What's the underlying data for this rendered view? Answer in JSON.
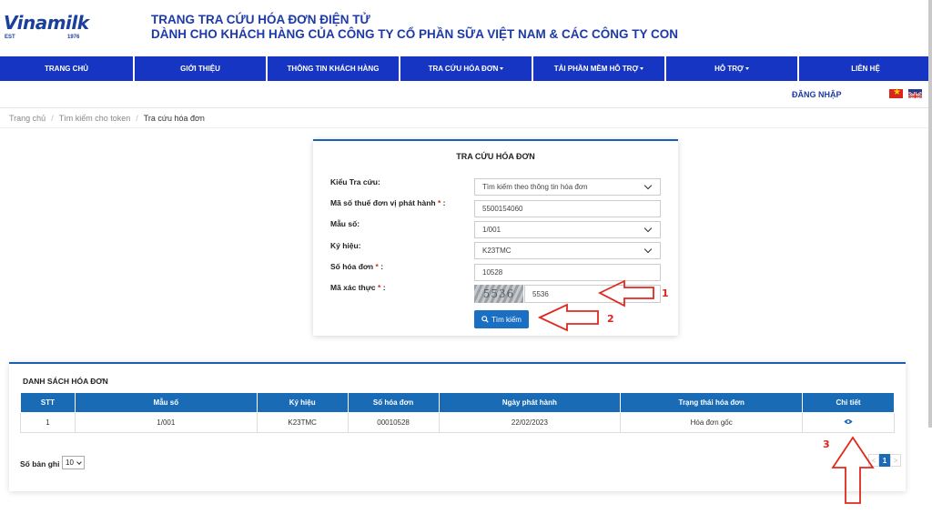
{
  "logo": {
    "brand": "Vinamilk",
    "est": "EST",
    "year": "1976"
  },
  "header": {
    "title_line1": "TRANG TRA CỨU HÓA ĐƠN ĐIỆN TỬ",
    "title_line2": "DÀNH CHO KHÁCH HÀNG CỦA CÔNG TY CỔ PHẦN SỮA VIỆT NAM & CÁC CÔNG TY CON"
  },
  "nav": {
    "items": [
      {
        "label": "TRANG CHỦ"
      },
      {
        "label": "GIỚI THIỆU"
      },
      {
        "label": "THÔNG TIN KHÁCH HÀNG"
      },
      {
        "label": "TRA CỨU HÓA ĐƠN"
      },
      {
        "label": "TẢI PHẦN MỀM HỖ TRỢ"
      },
      {
        "label": "HỖ TRỢ"
      },
      {
        "label": "LIÊN HỆ"
      }
    ]
  },
  "login_label": "ĐĂNG NHẬP",
  "languages": [
    "vi-flag-icon",
    "uk-flag-icon"
  ],
  "breadcrumb": [
    "Trang chủ",
    "Tìm kiếm cho token",
    "Tra cứu hóa đơn"
  ],
  "search_form": {
    "title": "TRA CỨU HÓA ĐƠN",
    "lookup_type_label": "Kiểu Tra cứu:",
    "lookup_type_value": "Tìm kiếm theo thông tin hóa đơn",
    "tax_code_label": "Mã số thuế đơn vị phát hành",
    "tax_code_value": "5500154060",
    "template_label": "Mẫu số:",
    "template_value": "1/001",
    "symbol_label": "Ký hiệu:",
    "symbol_value": "K23TMC",
    "invoice_no_label": "Số hóa đơn",
    "invoice_no_value": "10528",
    "captcha_label": "Mã xác thực",
    "captcha_image_text": "5536",
    "captcha_value": "5536",
    "search_button": "Tìm kiếm",
    "required_mark": "*",
    "colon": ":"
  },
  "results": {
    "title": "DANH SÁCH HÓA ĐƠN",
    "columns": [
      "STT",
      "Mẫu số",
      "Ký hiệu",
      "Số hóa đơn",
      "Ngày phát hành",
      "Trạng thái hóa đơn",
      "Chi tiết"
    ],
    "rows": [
      {
        "stt": "1",
        "template": "1/001",
        "symbol": "K23TMC",
        "number": "00010528",
        "date": "22/02/2023",
        "status": "Hóa đơn gốc",
        "detail_icon": "eye-icon"
      }
    ],
    "page_size_label": "Số bản ghi",
    "page_size_value": "10",
    "pagination": {
      "prev": "<",
      "current": "1",
      "next": ">"
    }
  },
  "annotations": [
    "1",
    "2",
    "3"
  ],
  "colors": {
    "nav_blue": "#1535c2",
    "table_header": "#1a6bb5",
    "annotation_red": "#d9261c",
    "title_blue": "#1d3aa6"
  }
}
